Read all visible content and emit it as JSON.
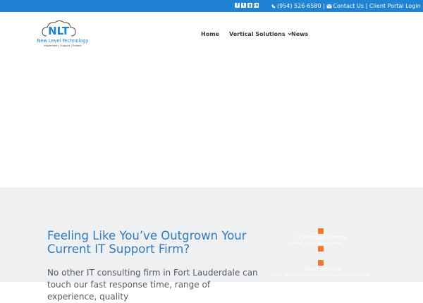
{
  "topbar": {
    "social_icons": [
      "facebook-icon",
      "twitter-icon",
      "google-plus-icon",
      "linkedin-icon"
    ],
    "phone": "(954) 526-6580",
    "separator1": "|",
    "contact_label": "Contact Us",
    "separator2": "|",
    "portal_label": "Client Portal Login",
    "bg_color": "#1f82d2"
  },
  "logo": {
    "mark": "NLT",
    "name": "New Level Technology",
    "tagline": "Implement | Support | Protect"
  },
  "nav": {
    "items": [
      {
        "label": "Home"
      },
      {
        "label": "Vertical Solutions",
        "has_dropdown": true
      },
      {
        "label": "News"
      }
    ]
  },
  "main": {
    "headline": "Feeling Like You’ve Outgrown Your Current IT Support Firm?",
    "paragraph": "No other IT consulting firm in Fort Lauderdale can touch our fast response time, range of experience, quality"
  },
  "services": [
    {
      "title": "IT Managed Services",
      "subtitle": "Network & Data Management"
    },
    {
      "title": "",
      "subtitle": ""
    },
    {
      "title": "Cloud Services",
      "subtitle": "Office 365, Azure & hosted cloud solutions for business"
    }
  ],
  "colors": {
    "accent": "#f27a2b",
    "headline": "#2f79bd",
    "band": "#eef0f2"
  }
}
